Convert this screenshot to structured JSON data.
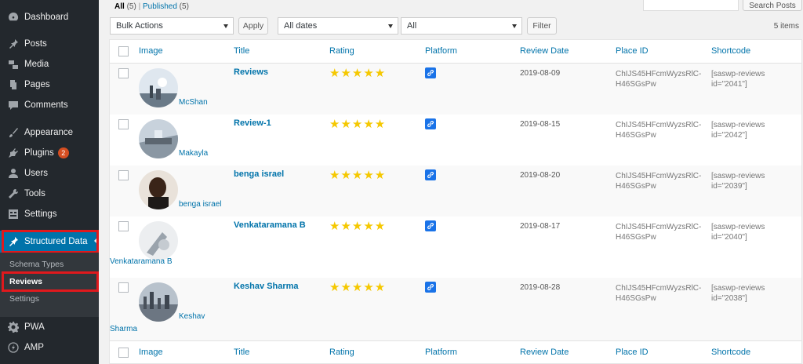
{
  "sidebar": {
    "items": [
      {
        "label": "Dashboard",
        "icon": "dashboard-icon"
      },
      {
        "label": "Posts",
        "icon": "pin-icon"
      },
      {
        "label": "Media",
        "icon": "media-icon"
      },
      {
        "label": "Pages",
        "icon": "page-icon"
      },
      {
        "label": "Comments",
        "icon": "comment-icon"
      },
      {
        "label": "Appearance",
        "icon": "brush-icon"
      },
      {
        "label": "Plugins",
        "icon": "plugin-icon",
        "badge": "2"
      },
      {
        "label": "Users",
        "icon": "user-icon"
      },
      {
        "label": "Tools",
        "icon": "wrench-icon"
      },
      {
        "label": "Settings",
        "icon": "settings-icon"
      },
      {
        "label": "Structured Data",
        "icon": "pin-icon"
      },
      {
        "label": "PWA",
        "icon": "gear-icon"
      },
      {
        "label": "AMP",
        "icon": "amp-icon"
      }
    ],
    "submenu": [
      "Schema Types",
      "Reviews",
      "Settings"
    ]
  },
  "views": {
    "all": "All",
    "all_count": "(5)",
    "sep": "|",
    "published": "Published",
    "published_count": "(5)"
  },
  "search": {
    "button": "Search Posts"
  },
  "toolbar": {
    "bulk_actions": "Bulk Actions",
    "apply": "Apply",
    "dates": "All dates",
    "all": "All",
    "filter": "Filter",
    "items_count": "5 items"
  },
  "columns": [
    "Image",
    "Title",
    "Rating",
    "Platform",
    "Review Date",
    "Place ID",
    "Shortcode"
  ],
  "rows": [
    {
      "author": "McShan",
      "title": "Reviews",
      "stars": "★★★★★",
      "date": "2019-08-09",
      "place_1": "ChIJS45HFcmWyzsRlC-",
      "place_2": "H46SGsPw",
      "short_1": "[saswp-reviews",
      "short_2": "id=\"2041\"]"
    },
    {
      "author": "Makayla",
      "title": "Review-1",
      "stars": "★★★★★",
      "date": "2019-08-15",
      "place_1": "ChIJS45HFcmWyzsRlC-",
      "place_2": "H46SGsPw",
      "short_1": "[saswp-reviews",
      "short_2": "id=\"2042\"]"
    },
    {
      "author": "benga israel",
      "title": "benga israel",
      "stars": "★★★★★",
      "date": "2019-08-20",
      "place_1": "ChIJS45HFcmWyzsRlC-",
      "place_2": "H46SGsPw",
      "short_1": "[saswp-reviews",
      "short_2": "id=\"2039\"]"
    },
    {
      "author": "Venkataramana B",
      "title": "Venkataramana B",
      "stars": "★★★★★",
      "date": "2019-08-17",
      "place_1": "ChIJS45HFcmWyzsRlC-",
      "place_2": "H46SGsPw",
      "short_1": "[saswp-reviews",
      "short_2": "id=\"2040\"]"
    },
    {
      "author_1": "Keshav",
      "author_2": "Sharma",
      "title": "Keshav Sharma",
      "stars": "★★★★★",
      "date": "2019-08-28",
      "place_1": "ChIJS45HFcmWyzsRlC-",
      "place_2": "H46SGsPw",
      "short_1": "[saswp-reviews",
      "short_2": "id=\"2038\"]"
    }
  ],
  "colors": {
    "sidebar": "#23282d",
    "accent": "#0073aa",
    "star": "#f5c800",
    "highlight": "#e0191d"
  }
}
